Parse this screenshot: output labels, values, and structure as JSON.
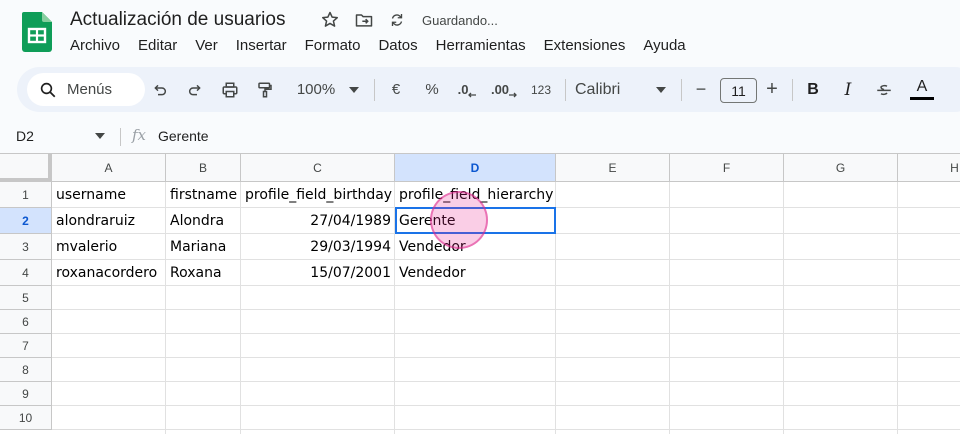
{
  "app": {
    "title": "Actualización de usuarios",
    "saving_status": "Guardando...",
    "icons": [
      "sheets-logo-icon",
      "star-icon",
      "move-to-folder-icon",
      "sync-icon"
    ]
  },
  "menu": [
    "Archivo",
    "Editar",
    "Ver",
    "Insertar",
    "Formato",
    "Datos",
    "Herramientas",
    "Extensiones",
    "Ayuda"
  ],
  "toolbar": {
    "search_label": "Menús",
    "zoom": "100%",
    "currency": "€",
    "percent": "%",
    "decrease_decimals": ".0",
    "increase_decimals": ".00",
    "number_format": "123",
    "font": "Calibri",
    "font_size": "11",
    "minus": "−",
    "plus": "+",
    "bold": "B",
    "italic": "I",
    "text_color": "A",
    "colors": {
      "accent": "#1a73e8",
      "toolbar_bg": "#edf2fa",
      "sheets_green": "#0f9d58"
    }
  },
  "formula_bar": {
    "cell_ref": "D2",
    "fx": "fx",
    "value": "Gerente"
  },
  "grid": {
    "columns": [
      "A",
      "B",
      "C",
      "D",
      "E",
      "F",
      "G",
      "H"
    ],
    "selected_column": "D",
    "rows": [
      "1",
      "2",
      "3",
      "4",
      "5",
      "6",
      "7",
      "8",
      "9",
      "10"
    ],
    "selected_row": "2",
    "cells": [
      [
        "username",
        "firstname",
        "profile_field_birthday",
        "profile_field_hierarchy"
      ],
      [
        "alondraruiz",
        "Alondra",
        "27/04/1989",
        "Gerente"
      ],
      [
        "mvalerio",
        "Mariana",
        "29/03/1994",
        "Vendedor"
      ],
      [
        "roxanacordero",
        "Roxana",
        "15/07/2001",
        "Vendedor"
      ]
    ]
  }
}
